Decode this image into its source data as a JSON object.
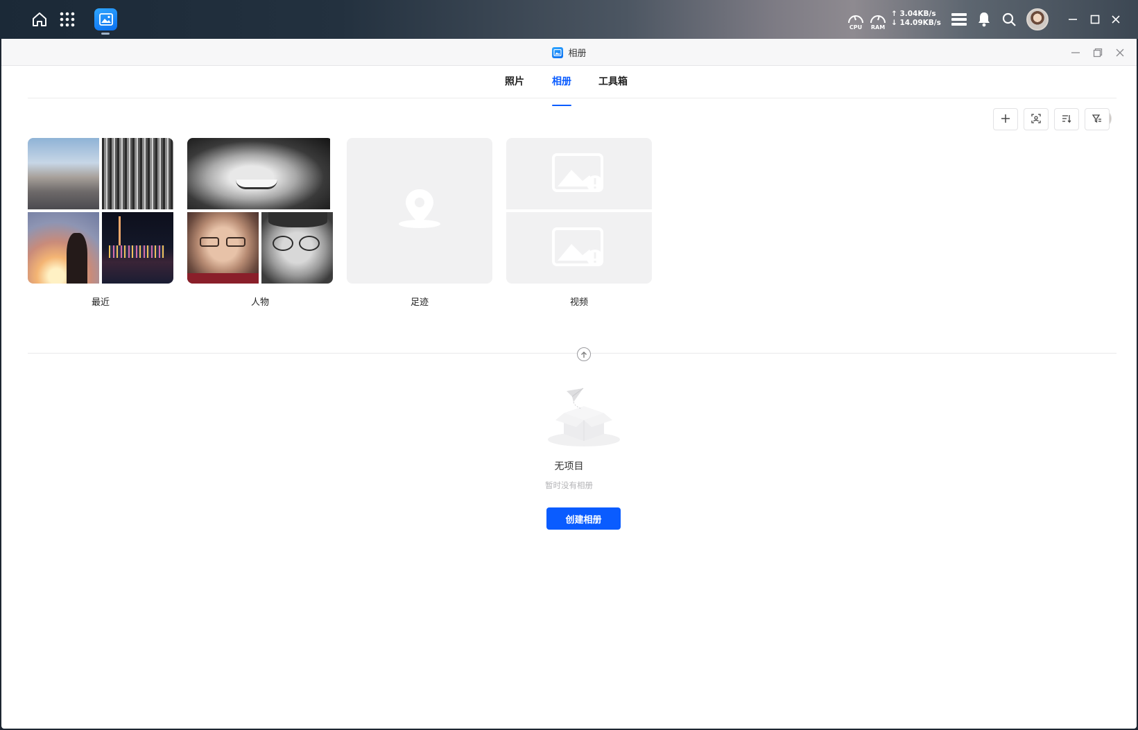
{
  "taskbar": {
    "cpu_label": "CPU",
    "ram_label": "RAM",
    "upload_speed": "↑ 3.04KB/s",
    "download_speed": "↓ 14.09KB/s",
    "icons": [
      "home-icon",
      "app-grid-icon",
      "photos-app-icon",
      "storage-icon",
      "bell-icon",
      "search-icon",
      "avatar",
      "minimize-icon",
      "maximize-icon",
      "close-icon"
    ]
  },
  "window": {
    "title": "相册"
  },
  "tabs": [
    {
      "label": "照片",
      "active": false
    },
    {
      "label": "相册",
      "active": true
    },
    {
      "label": "工具箱",
      "active": false
    }
  ],
  "toolbar": {
    "icons": [
      "add-icon",
      "face-scan-icon",
      "sort-icon",
      "filter-icon"
    ]
  },
  "albums": [
    {
      "label": "最近"
    },
    {
      "label": "人物"
    },
    {
      "label": "足迹"
    },
    {
      "label": "视频"
    }
  ],
  "empty_state": {
    "title": "无项目",
    "subtitle": "暂时没有相册",
    "button_label": "创建相册"
  },
  "colors": {
    "accent": "#0a5cff",
    "placeholder_bg": "#f1f1f2"
  }
}
